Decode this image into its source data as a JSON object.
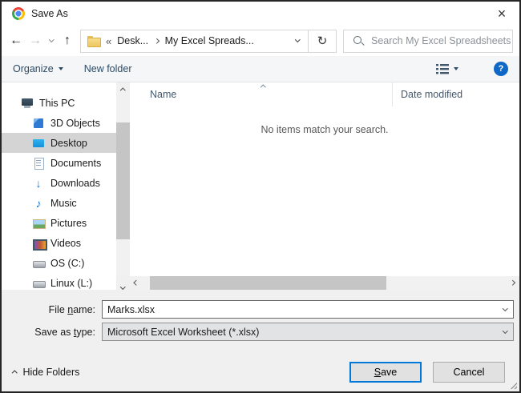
{
  "window": {
    "title": "Save As",
    "close_glyph": "×"
  },
  "nav": {
    "back_glyph": "←",
    "forward_glyph": "→",
    "up_glyph": "↑",
    "refresh_glyph": "↻",
    "address": {
      "overflow_glyph": "«",
      "crumbs": [
        {
          "label": "Desk..."
        },
        {
          "label": "My Excel Spreads..."
        }
      ]
    },
    "search": {
      "placeholder": "Search My Excel Spreadsheets"
    }
  },
  "toolbar": {
    "organize_label": "Organize",
    "new_folder_label": "New folder",
    "help_glyph": "?"
  },
  "sidebar": {
    "items": [
      {
        "name": "sidebar-item-this-pc",
        "label": "This PC",
        "icon": "this-pc-icon",
        "icon_class": "icon-pc",
        "level": 0
      },
      {
        "name": "sidebar-item-3d-objects",
        "label": "3D Objects",
        "icon": "3d-objects-icon",
        "icon_class": "icon-cube",
        "level": 1
      },
      {
        "name": "sidebar-item-desktop",
        "label": "Desktop",
        "icon": "desktop-icon",
        "icon_class": "icon-desktop",
        "level": 1,
        "selected": true
      },
      {
        "name": "sidebar-item-documents",
        "label": "Documents",
        "icon": "documents-icon",
        "icon_class": "icon-doc",
        "level": 1
      },
      {
        "name": "sidebar-item-downloads",
        "label": "Downloads",
        "icon": "downloads-icon",
        "icon_class": "icon-glyph",
        "level": 1,
        "glyph": "↓"
      },
      {
        "name": "sidebar-item-music",
        "label": "Music",
        "icon": "music-icon",
        "icon_class": "icon-glyph",
        "level": 1,
        "glyph": "♪"
      },
      {
        "name": "sidebar-item-pictures",
        "label": "Pictures",
        "icon": "pictures-icon",
        "icon_class": "icon-picture",
        "level": 1
      },
      {
        "name": "sidebar-item-videos",
        "label": "Videos",
        "icon": "videos-icon",
        "icon_class": "icon-video",
        "level": 1
      },
      {
        "name": "sidebar-item-os-c",
        "label": "OS (C:)",
        "icon": "os-c-drive-icon",
        "icon_class": "icon-drive",
        "level": 1
      },
      {
        "name": "sidebar-item-linux-l",
        "label": "Linux (L:)",
        "icon": "linux-drive-icon",
        "icon_class": "icon-drive",
        "level": 1
      }
    ]
  },
  "file_list": {
    "name_header": "Name",
    "date_header": "Date modified",
    "empty_message": "No items match your search."
  },
  "fields": {
    "file_name_label": {
      "pre": "File ",
      "key": "n",
      "post": "ame:"
    },
    "file_name_value": "Marks.xlsx",
    "save_as_type_label": {
      "pre": "Save as ",
      "key": "t",
      "post": "ype:"
    },
    "save_as_type_value": "Microsoft Excel Worksheet (*.xlsx)"
  },
  "footer": {
    "hide_folders_label": "Hide Folders",
    "save_button": {
      "pre": "",
      "key": "S",
      "post": "ave"
    },
    "cancel_label": "Cancel"
  },
  "colors": {
    "accent": "#0078d7",
    "help_blue": "#1068c6",
    "selection_gray": "#d4d4d4"
  }
}
